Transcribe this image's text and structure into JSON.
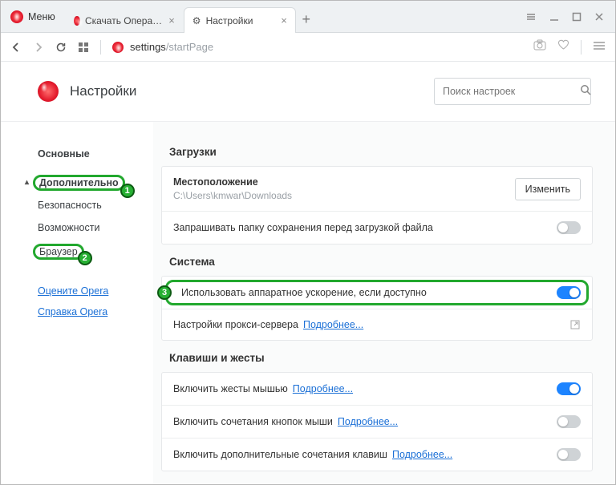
{
  "chrome": {
    "menu": "Меню",
    "tabs": [
      {
        "label": "Скачать Опера для компь",
        "active": false,
        "icon": "opera"
      },
      {
        "label": "Настройки",
        "active": true,
        "icon": "gear"
      }
    ],
    "window_buttons": [
      "defaults",
      "minimize",
      "maximize",
      "close"
    ]
  },
  "nav": {
    "url_host": "settings",
    "url_path": "/startPage"
  },
  "settings_header": {
    "title": "Настройки",
    "search_placeholder": "Поиск настроек"
  },
  "sidebar": {
    "basic": "Основные",
    "advanced": "Дополнительно",
    "security": "Безопасность",
    "features": "Возможности",
    "browser": "Браузер",
    "rate_link": "Оцените Opera",
    "help_link": "Справка Opera"
  },
  "annotations": {
    "1": "1",
    "2": "2",
    "3": "3"
  },
  "sections": {
    "downloads": {
      "title": "Загрузки",
      "location_label": "Местоположение",
      "location_value": "C:\\Users\\kmwar\\Downloads",
      "change_btn": "Изменить",
      "ask_before": "Запрашивать папку сохранения перед загрузкой файла",
      "ask_before_on": false
    },
    "system": {
      "title": "Система",
      "hw_accel": "Использовать аппаратное ускорение, если доступно",
      "hw_accel_on": true,
      "proxy_label": "Настройки прокси-сервера",
      "more": "Подробнее..."
    },
    "keys": {
      "title": "Клавиши и жесты",
      "mouse_gestures": "Включить жесты мышью",
      "mouse_gestures_on": true,
      "rocker": "Включить сочетания кнопок мыши",
      "rocker_on": false,
      "extra_keys": "Включить дополнительные сочетания клавиш",
      "extra_keys_on": false,
      "more": "Подробнее..."
    }
  }
}
